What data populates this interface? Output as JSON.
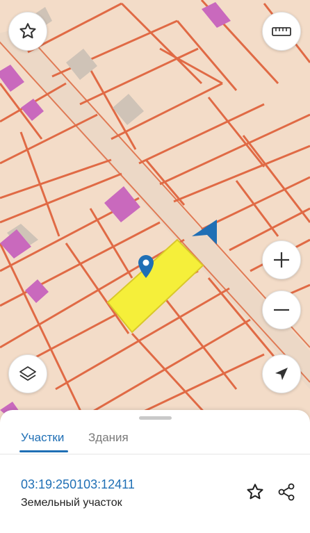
{
  "map": {
    "colors": {
      "background": "#f3dcc8",
      "road": "#ecd8c6",
      "boundary": "#e06a45",
      "building": "#cfc3b7",
      "poi": "#c969bd",
      "selected_parcel": "#f5ef3a",
      "selected_border": "#d9c82a",
      "marker": "#1f6fb5",
      "arrow": "#1f6fb5"
    },
    "controls": {
      "favorite_icon": "star-icon",
      "ruler_icon": "ruler-icon",
      "zoom_in_icon": "plus-icon",
      "zoom_out_icon": "minus-icon",
      "layers_icon": "layers-icon",
      "locate_icon": "navigation-arrow-icon"
    }
  },
  "sheet": {
    "tabs": [
      {
        "label": "Участки",
        "active": true
      },
      {
        "label": "Здания",
        "active": false
      }
    ],
    "parcel": {
      "number": "03:19:250103:12411",
      "type": "Земельный участок"
    },
    "actions": {
      "favorite_icon": "star-outline-icon",
      "share_icon": "share-icon"
    }
  }
}
